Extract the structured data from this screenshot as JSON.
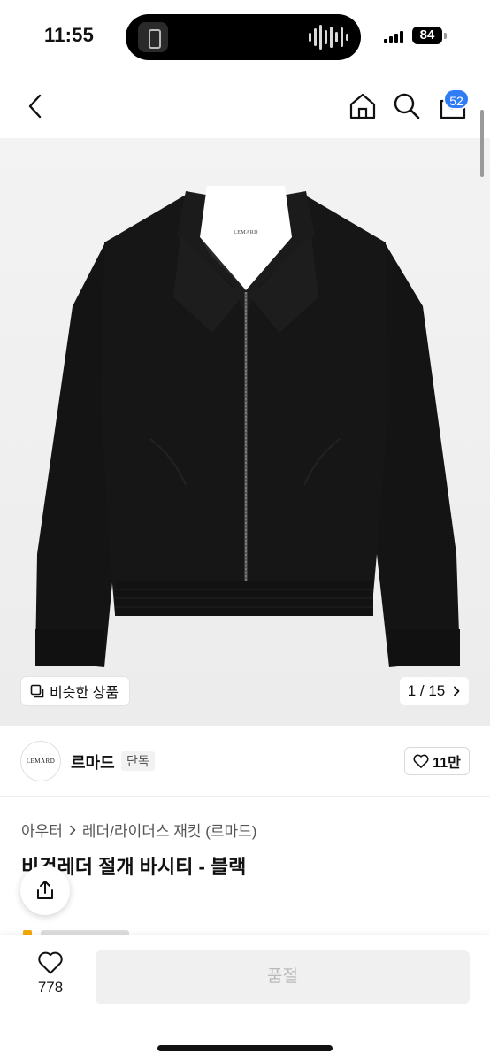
{
  "status_bar": {
    "time": "11:55",
    "battery": "84"
  },
  "header": {
    "cart_count": "52"
  },
  "gallery": {
    "similar_label": "비슷한 상품",
    "pager": "1 / 15",
    "jacket_logo": "LEMARD"
  },
  "brand": {
    "logo_text": "LEMARD",
    "name": "르마드",
    "tag": "단독",
    "followers": "11만"
  },
  "breadcrumb": {
    "category": "아우터",
    "subcategory": "레더/라이더스 재킷 (르마드)"
  },
  "product": {
    "title": "비건레더 절개 바시티 - 블랙"
  },
  "bottom_bar": {
    "like_count": "778",
    "buy_label": "품절"
  },
  "colors": {
    "accent": "#2f7cf6",
    "disabled_bg": "#f0f0f0",
    "disabled_text": "#b9b9b9",
    "image_bg": "#f0f0f0"
  },
  "icons": [
    "back-icon",
    "home-icon",
    "search-icon",
    "cart-icon",
    "similar-icon",
    "chevron-right-icon",
    "heart-icon",
    "share-icon"
  ]
}
